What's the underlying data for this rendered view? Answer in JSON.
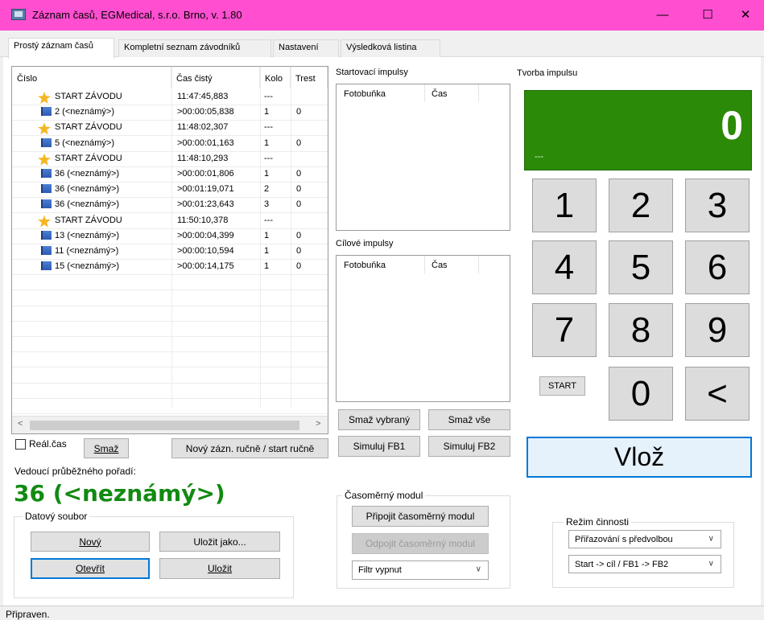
{
  "window": {
    "title": "Záznam časů, EGMedical, s.r.o. Brno,  v. 1.80",
    "minimize": "—",
    "maximize": "☐",
    "close": "✕"
  },
  "tabs": [
    {
      "label": "Prostý záznam časů",
      "active": true
    },
    {
      "label": "Kompletní seznam závodníků",
      "active": false
    },
    {
      "label": "Nastavení",
      "active": false
    },
    {
      "label": "Výsledková listina",
      "active": false
    }
  ],
  "records": {
    "columns": [
      "Číslo",
      "Čas čistý",
      "Kolo",
      "Trest"
    ],
    "rows": [
      {
        "icon": "star",
        "cislo": "START ZÁVODU",
        "cas": "11:47:45,883",
        "kolo": "---",
        "trest": ""
      },
      {
        "icon": "flag",
        "cislo": "2 (<neznámý>)",
        "cas": ">00:00:05,838",
        "kolo": "1",
        "trest": "0"
      },
      {
        "icon": "star",
        "cislo": "START ZÁVODU",
        "cas": "11:48:02,307",
        "kolo": "---",
        "trest": ""
      },
      {
        "icon": "flag",
        "cislo": "5 (<neznámý>)",
        "cas": ">00:00:01,163",
        "kolo": "1",
        "trest": "0"
      },
      {
        "icon": "star",
        "cislo": "START ZÁVODU",
        "cas": "11:48:10,293",
        "kolo": "---",
        "trest": ""
      },
      {
        "icon": "flag",
        "cislo": "36 (<neznámý>)",
        "cas": ">00:00:01,806",
        "kolo": "1",
        "trest": "0"
      },
      {
        "icon": "flag",
        "cislo": "36 (<neznámý>)",
        "cas": ">00:01:19,071",
        "kolo": "2",
        "trest": "0"
      },
      {
        "icon": "flag",
        "cislo": "36 (<neznámý>)",
        "cas": ">00:01:23,643",
        "kolo": "3",
        "trest": "0"
      },
      {
        "icon": "star",
        "cislo": "START ZÁVODU",
        "cas": "11:50:10,378",
        "kolo": "---",
        "trest": ""
      },
      {
        "icon": "flag",
        "cislo": "13 (<neznámý>)",
        "cas": ">00:00:04,399",
        "kolo": "1",
        "trest": "0"
      },
      {
        "icon": "flag",
        "cislo": "11 (<neznámý>)",
        "cas": ">00:00:10,594",
        "kolo": "1",
        "trest": "0"
      },
      {
        "icon": "flag",
        "cislo": "15 (<neznámý>)",
        "cas": ">00:00:14,175",
        "kolo": "1",
        "trest": "0"
      }
    ],
    "scroll_left": "<",
    "scroll_right": ">"
  },
  "controls": {
    "real_cas_label": "Reál.čas",
    "smaz_label": "Smaž",
    "novy_zaznam_label": "Nový zázn. ručně / start ručně"
  },
  "leader": {
    "label": "Vedoucí průběžného pořadí:",
    "value": "36 (<neznámý>)"
  },
  "datovy_soubor": {
    "title": "Datový soubor",
    "novy": "Nový",
    "ulozit_jako": "Uložit jako...",
    "otevrit": "Otevřít",
    "ulozit": "Uložit"
  },
  "start_impulses": {
    "title": "Startovací impulsy",
    "col_fotobunka": "Fotobuňka",
    "col_cas": "Čas"
  },
  "finish_impulses": {
    "title": "Cílové impulsy",
    "col_fotobunka": "Fotobuňka",
    "col_cas": "Čas"
  },
  "impulse_buttons": {
    "smaz_vybrany": "Smaž vybraný",
    "smaz_vse": "Smaž vše",
    "simuluj_fb1": "Simuluj FB1",
    "simuluj_fb2": "Simuluj FB2"
  },
  "casomerny_modul": {
    "title": "Časoměrný modul",
    "pripojit": "Připojit časoměrný modul",
    "odpojit": "Odpojit časoměrný modul",
    "filtr_value": "Filtr vypnut"
  },
  "tvorba_impulsu": {
    "title": "Tvorba impulsu",
    "display_value": "0",
    "display_sub": "---",
    "keys": [
      "1",
      "2",
      "3",
      "4",
      "5",
      "6",
      "7",
      "8",
      "9"
    ],
    "start_label": "START",
    "zero": "0",
    "backspace": "<",
    "vloz": "Vlož"
  },
  "rezim_cinnosti": {
    "title": "Režim činnosti",
    "mode_value": "Přiřazování s předvolbou",
    "route_value": "Start -> cíl / FB1 -> FB2"
  },
  "status": {
    "text": "Připraven."
  }
}
